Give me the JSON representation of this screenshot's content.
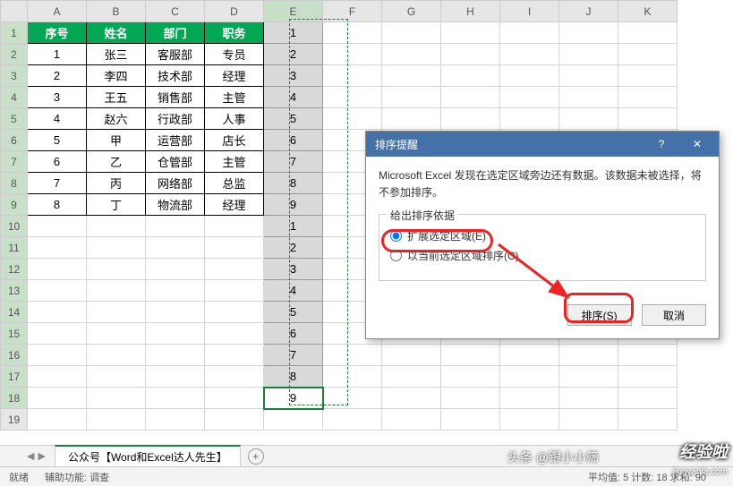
{
  "columns": [
    "A",
    "B",
    "C",
    "D",
    "E",
    "F",
    "G",
    "H",
    "I",
    "J",
    "K"
  ],
  "rows": [
    1,
    2,
    3,
    4,
    5,
    6,
    7,
    8,
    9,
    10,
    11,
    12,
    13,
    14,
    15,
    16,
    17,
    18,
    19
  ],
  "table": {
    "headers": [
      "序号",
      "姓名",
      "部门",
      "职务"
    ],
    "data": [
      [
        "1",
        "张三",
        "客服部",
        "专员"
      ],
      [
        "2",
        "李四",
        "技术部",
        "经理"
      ],
      [
        "3",
        "王五",
        "销售部",
        "主管"
      ],
      [
        "4",
        "赵六",
        "行政部",
        "人事"
      ],
      [
        "5",
        "甲",
        "运营部",
        "店长"
      ],
      [
        "6",
        "乙",
        "仓管部",
        "主管"
      ],
      [
        "7",
        "丙",
        "网络部",
        "总监"
      ],
      [
        "8",
        "丁",
        "物流部",
        "经理"
      ]
    ]
  },
  "colE": [
    "1",
    "2",
    "3",
    "4",
    "5",
    "6",
    "7",
    "8",
    "9",
    "1",
    "2",
    "3",
    "4",
    "5",
    "6",
    "7",
    "8",
    "9"
  ],
  "dialog": {
    "title": "排序提醒",
    "msg": "Microsoft Excel 发现在选定区域旁边还有数据。该数据未被选择，将不参加排序。",
    "group_label": "给出排序依据",
    "opt1": "扩展选定区域(E)",
    "opt2": "以当前选定区域排序(C)",
    "btn_sort": "排序(S)",
    "btn_cancel": "取消"
  },
  "sheet_tab": "公众号【Word和Excel达人先生】",
  "status": {
    "left1": "就绪",
    "left2": "辅助功能: 调查",
    "mid": "平均值: 5    计数: 18    求和: 90"
  },
  "watermark": {
    "a": "经验啦",
    "b": "jingyanla.com",
    "c": "头条 @跟小小筛"
  }
}
